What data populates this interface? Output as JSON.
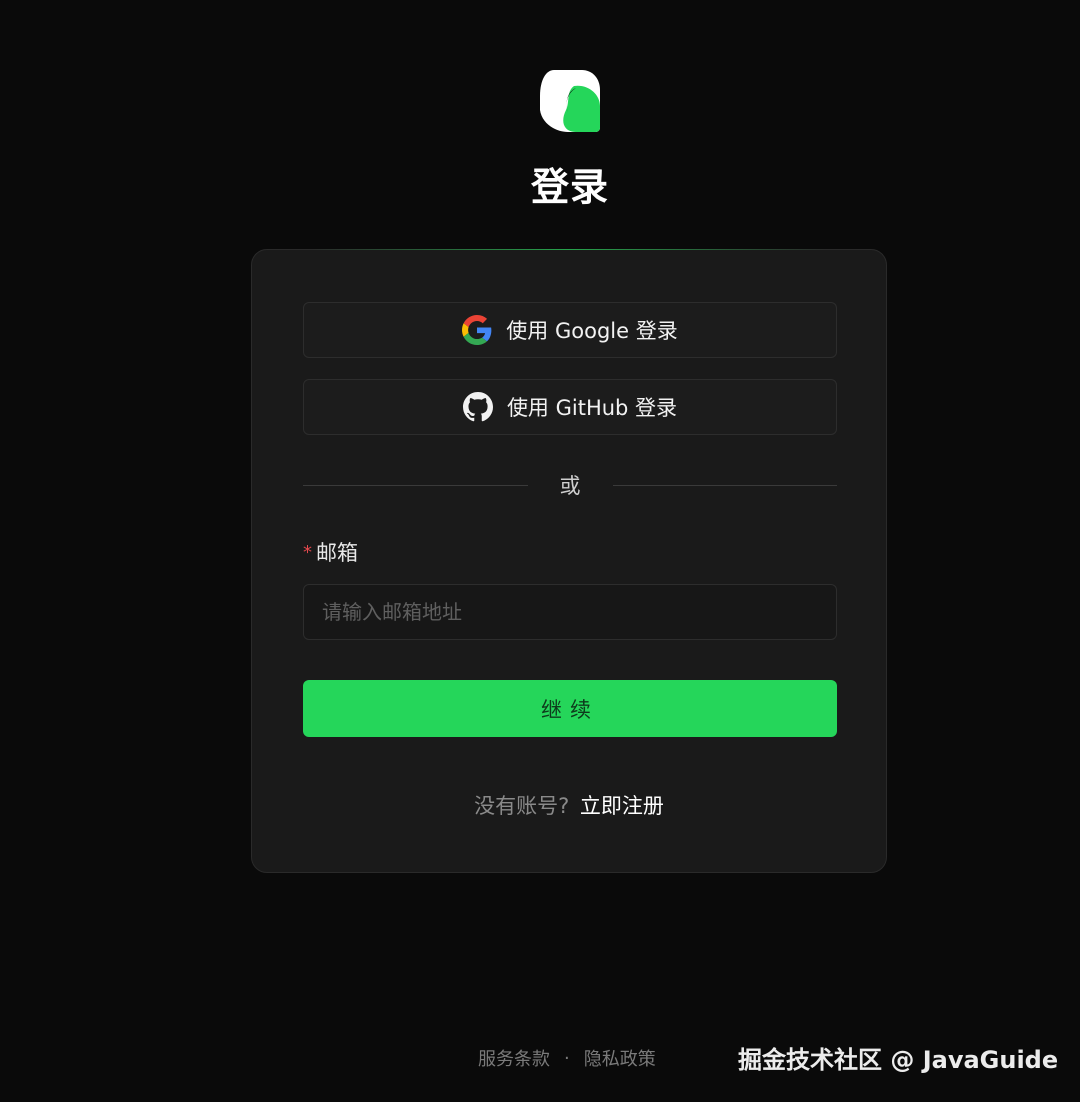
{
  "header": {
    "logo": "app-logo",
    "title": "登录"
  },
  "oauth": {
    "google_label": "使用 Google 登录",
    "github_label": "使用 GitHub 登录"
  },
  "divider": {
    "text": "或"
  },
  "form": {
    "email_label": "邮箱",
    "required_mark": "*",
    "email_placeholder": "请输入邮箱地址",
    "email_value": "",
    "continue_label": "继续"
  },
  "signup": {
    "prompt": "没有账号?",
    "link": "立即注册"
  },
  "footer": {
    "terms": "服务条款",
    "separator": "·",
    "privacy": "隐私政策"
  },
  "watermark": "掘金技术社区 @ JavaGuide",
  "colors": {
    "background": "#0a0a0a",
    "card": "#1a1a1a",
    "accent": "#25d65a",
    "required": "#e5484d"
  }
}
